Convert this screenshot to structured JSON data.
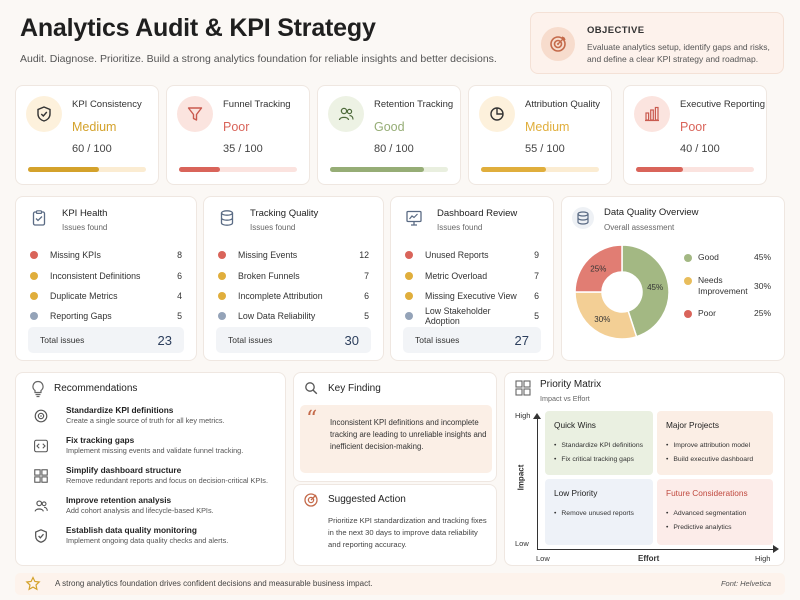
{
  "header": {
    "title": "Analytics Audit & KPI Strategy",
    "subtitle": "Audit. Diagnose. Prioritize. Build a strong analytics foundation for reliable insights and better decisions."
  },
  "objective": {
    "label": "OBJECTIVE",
    "text": "Evaluate analytics setup, identify gaps and risks, and define a clear KPI strategy and roadmap.",
    "icon": "target-icon"
  },
  "kpis": [
    {
      "name": "KPI Consistency",
      "level": "Medium",
      "score": "60 / 100",
      "progress": 0.6,
      "color": "#d4a22b",
      "track": "#fbecd2",
      "icon_bg": "#fdf1dc",
      "icon": "shield-check-icon"
    },
    {
      "name": "Funnel Tracking",
      "level": "Poor",
      "score": "35 / 100",
      "progress": 0.35,
      "color": "#d9645a",
      "track": "#fbe3df",
      "icon_bg": "#fbe4df",
      "icon": "funnel-icon"
    },
    {
      "name": "Retention Tracking",
      "level": "Good",
      "score": "80 / 100",
      "progress": 0.8,
      "color": "#96ad76",
      "track": "#e9efdf",
      "icon_bg": "#edf2e4",
      "icon": "users-icon"
    },
    {
      "name": "Attribution Quality",
      "level": "Medium",
      "score": "55 / 100",
      "progress": 0.55,
      "color": "#e0ae3c",
      "track": "#fbecd2",
      "icon_bg": "#fdf1dc",
      "icon": "pie-icon"
    },
    {
      "name": "Executive Reporting",
      "level": "Poor",
      "score": "40 / 100",
      "progress": 0.4,
      "color": "#d9645a",
      "track": "#fbe3df",
      "icon_bg": "#fbe4df",
      "icon": "bar-chart-icon"
    }
  ],
  "panels": [
    {
      "title": "KPI Health",
      "subtitle": "Issues found",
      "icon": "clipboard-icon",
      "rows": [
        {
          "label": "Missing KPIs",
          "value": "8",
          "color": "#d9645a"
        },
        {
          "label": "Inconsistent Definitions",
          "value": "6",
          "color": "#e0ae3c"
        },
        {
          "label": "Duplicate Metrics",
          "value": "4",
          "color": "#e0ae3c"
        },
        {
          "label": "Reporting Gaps",
          "value": "5",
          "color": "#94a3b8"
        }
      ],
      "total_label": "Total issues",
      "total": "23"
    },
    {
      "title": "Tracking Quality",
      "subtitle": "Issues found",
      "icon": "database-icon",
      "rows": [
        {
          "label": "Missing Events",
          "value": "12",
          "color": "#d9645a"
        },
        {
          "label": "Broken Funnels",
          "value": "7",
          "color": "#e0ae3c"
        },
        {
          "label": "Incomplete Attribution",
          "value": "6",
          "color": "#e0ae3c"
        },
        {
          "label": "Low Data Reliability",
          "value": "5",
          "color": "#94a3b8"
        }
      ],
      "total_label": "Total issues",
      "total": "30"
    },
    {
      "title": "Dashboard Review",
      "subtitle": "Issues found",
      "icon": "monitor-chart-icon",
      "rows": [
        {
          "label": "Unused Reports",
          "value": "9",
          "color": "#d9645a"
        },
        {
          "label": "Metric Overload",
          "value": "7",
          "color": "#e0ae3c"
        },
        {
          "label": "Missing Executive View",
          "value": "6",
          "color": "#e0ae3c"
        },
        {
          "label": "Low Stakeholder Adoption",
          "value": "5",
          "color": "#94a3b8"
        }
      ],
      "total_label": "Total issues",
      "total": "27"
    }
  ],
  "data_quality": {
    "title": "Data Quality Overview",
    "subtitle": "Overall assessment",
    "icon": "database-icon",
    "chart_data": {
      "type": "pie",
      "categories": [
        "Good",
        "Needs Improvement",
        "Poor"
      ],
      "values": [
        45,
        30,
        25
      ],
      "labels": [
        "45%",
        "30%",
        "25%"
      ],
      "colors": [
        "#a3b883",
        "#f3cf95",
        "#e17d73"
      ]
    },
    "legend": [
      {
        "label": "Good",
        "value": "45%",
        "color": "#a3b883"
      },
      {
        "label": "Needs Improvement",
        "value": "30%",
        "color": "#e8bd5c"
      },
      {
        "label": "Poor",
        "value": "25%",
        "color": "#d9645a"
      }
    ]
  },
  "recommendations": {
    "title": "Recommendations",
    "icon": "lightbulb-icon",
    "items": [
      {
        "title": "Standardize KPI definitions",
        "desc": "Create a single source of truth for all key metrics.",
        "icon": "target-icon"
      },
      {
        "title": "Fix tracking gaps",
        "desc": "Implement missing events and validate funnel tracking.",
        "icon": "code-icon"
      },
      {
        "title": "Simplify dashboard structure",
        "desc": "Remove redundant reports and focus on decision-critical KPIs.",
        "icon": "grid-icon"
      },
      {
        "title": "Improve retention analysis",
        "desc": "Add cohort analysis and lifecycle-based KPIs.",
        "icon": "users-icon"
      },
      {
        "title": "Establish data quality monitoring",
        "desc": "Implement ongoing data quality checks and alerts.",
        "icon": "shield-check-icon"
      }
    ]
  },
  "key_finding": {
    "title": "Key Finding",
    "icon": "search-icon",
    "quote_mark": "“",
    "text": "Inconsistent KPI definitions and incomplete tracking are leading to unreliable insights and inefficient decision-making."
  },
  "suggested_action": {
    "title": "Suggested Action",
    "icon": "target-icon",
    "text": "Prioritize KPI standardization and tracking fixes in the next 30 days to improve data reliability and reporting accuracy."
  },
  "priority_matrix": {
    "title": "Priority Matrix",
    "subtitle": "Impact vs Effort",
    "icon": "matrix-icon",
    "y_label": "Impact",
    "x_label": "Effort",
    "y_high": "High",
    "y_low": "Low",
    "x_low": "Low",
    "x_high": "High",
    "quadrants": [
      {
        "title": "Quick Wins",
        "items": [
          "Standardize KPI definitions",
          "Fix critical tracking gaps"
        ],
        "bg": "#eaf0e1",
        "color": "#222"
      },
      {
        "title": "Major Projects",
        "items": [
          "Improve attribution model",
          "Build executive dashboard"
        ],
        "bg": "#fbeee5",
        "color": "#222"
      },
      {
        "title": "Low Priority",
        "items": [
          "Remove unused reports"
        ],
        "bg": "#eef2f8",
        "color": "#222"
      },
      {
        "title": "Future Considerations",
        "items": [
          "Advanced segmentation",
          "Predictive analytics"
        ],
        "bg": "#fcece9",
        "color": "#c0493f"
      }
    ]
  },
  "footer": {
    "text": "A strong analytics foundation drives confident decisions and measurable business impact.",
    "font_note": "Font: Helvetica",
    "icon": "star-icon"
  }
}
